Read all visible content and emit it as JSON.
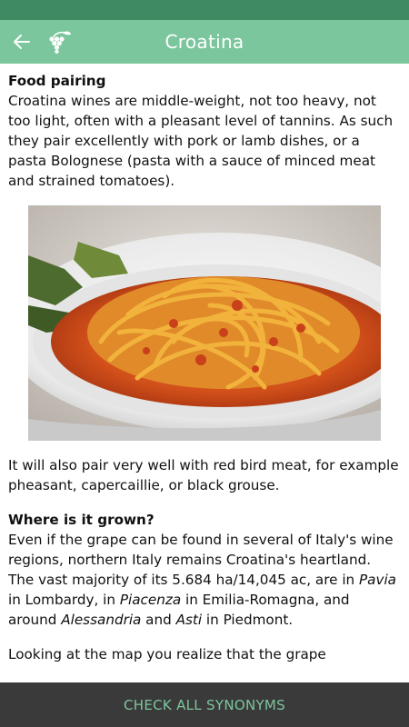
{
  "app_bar": {
    "title": "Croatina",
    "back_icon": "arrow-left-icon",
    "logo_icon": "grape-icon",
    "color": "#7cc69d",
    "status_color": "#3f8a63"
  },
  "article": {
    "food_pairing": {
      "heading": "Food pairing",
      "body": "Croatina wines are middle-weight, not too heavy, not too light, often with a pleasant level of tannins. As such they pair excellently with pork or lamb dishes, or a pasta Bolognese (pasta with a sauce of minced meat and strained tomatoes).",
      "after_image": "It will also pair very well with red bird meat, for example pheasant, capercaillie, or black grouse."
    },
    "where_grown": {
      "heading": "Where is it grown?",
      "p1": "Even if the grape can be found in several of Italy's wine regions, northern Italy remains Croatina's heartland. The vast majority of its 5.684 ha/14,045 ac, are in ",
      "pavia": "Pavia",
      "t1": " in Lombardy, in ",
      "piacenza": "Piacenza",
      "t2": " in Emilia-Romagna, and around ",
      "alessandria": "Alessandria",
      "t3": " and ",
      "asti": "Asti",
      "t4": " in Piedmont.",
      "p2": "Looking at the map you realize that the grape"
    }
  },
  "bottom_button": {
    "label": "CHECK ALL SYNONYMS",
    "color": "#7cc69d",
    "background": "#3a3a3a"
  }
}
